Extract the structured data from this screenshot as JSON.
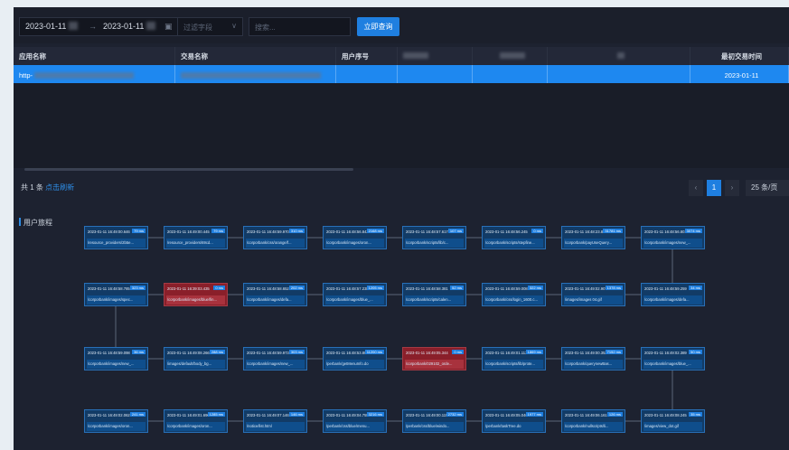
{
  "toolbar": {
    "start_date": "2023-01-11",
    "separator": "→",
    "end_date": "2023-01-11",
    "filter_placeholder": "过滤字段",
    "search_placeholder": "搜索...",
    "query_button": "立即查询"
  },
  "table": {
    "columns": [
      "应用名称",
      "交易名称",
      "用户序号",
      "",
      "",
      "",
      "最初交易时间"
    ],
    "row": {
      "app_name": "http-",
      "first_time": "2023-01-11"
    }
  },
  "pagination": {
    "total_prefix": "共",
    "total_count": "1",
    "total_suffix": "条",
    "refresh_link": "点击刷新",
    "prev": "‹",
    "current_page": "1",
    "next": "›",
    "page_size": "25 条/页"
  },
  "trail": {
    "title": "用户旅程",
    "nodes": [
      {
        "time": "2023-01-11 16:49:00.646",
        "dur": "79 ms",
        "path": "/resource_providers/2b5e...",
        "alert": false
      },
      {
        "time": "2023-01-11 16:49:00.445",
        "dur": "79 ms",
        "path": "/resource_providers/69cd...",
        "alert": false
      },
      {
        "time": "2023-01-11 16:48:59.970",
        "dur": "310 ms",
        "path": "/corporbank/css/orange/f...",
        "alert": false
      },
      {
        "time": "2023-01-11 16:48:56.842",
        "dur": "2168 ms",
        "path": "/corporbank/images/oron...",
        "alert": false
      },
      {
        "time": "2023-01-11 16:48:57.617",
        "dur": "107 ms",
        "path": "/corporbank/scripts/lib/c...",
        "alert": false
      },
      {
        "time": "2023-01-11 16:48:56.245",
        "dur": "0 ms",
        "path": "/corporbank/scripts/stepfine...",
        "alert": false
      },
      {
        "time": "2023-01-11 16:48:23.821",
        "dur": "31781 ms",
        "path": "/corporbank/payUseQuery...",
        "alert": false
      },
      {
        "time": "2023-01-11 16:48:56.801",
        "dur": "3074 ms",
        "path": "/corporbank/images/new_...",
        "alert": false
      },
      {
        "time": "2023-01-11 16:48:59.259",
        "dur": "34 ms",
        "path": "/corporbank/images/defa...",
        "alert": false
      },
      {
        "time": "2023-01-11 16:49:02.907",
        "dur": "1378 ms",
        "path": "/images/images 04.gif",
        "alert": false
      },
      {
        "time": "2023-01-11 16:48:59.008",
        "dur": "322 ms",
        "path": "/corporbank/css/login_1600.c...",
        "alert": false
      },
      {
        "time": "2023-01-11 16:48:58.381",
        "dur": "52 ms",
        "path": "/corporbank/scripts/calen...",
        "alert": false
      },
      {
        "time": "2023-01-11 16:48:57.238",
        "dur": "1205 ms",
        "path": "/corporbank/images/blue_...",
        "alert": false
      },
      {
        "time": "2023-01-11 16:48:58.652",
        "dur": "202 ms",
        "path": "/corporbank/images/defa...",
        "alert": false
      },
      {
        "time": "2023-01-11 16:39:03.435",
        "dur": "0 ms",
        "path": "/corporbank/images/blue/fin...",
        "alert": true
      },
      {
        "time": "2023-01-11 16:48:58.785",
        "dur": "323 ms",
        "path": "/corporbank/images/spec...",
        "alert": false
      },
      {
        "time": "2023-01-11 16:48:59.098",
        "dur": "36 ms",
        "path": "/corporbank/images/new_...",
        "alert": false
      },
      {
        "time": "2023-01-11 16:49:08.266",
        "dur": "288 ms",
        "path": "/images/default/body_bg...",
        "alert": false
      },
      {
        "time": "2023-01-11 16:48:59.973",
        "dur": "303 ms",
        "path": "/corporbank/images/new_...",
        "alert": false
      },
      {
        "time": "2023-01-11 16:48:53.807",
        "dur": "11200 ms",
        "path": "/perbank/getMenuInfo.do",
        "alert": false
      },
      {
        "time": "2023-01-11 16:49:05.344",
        "dur": "0 ms",
        "path": "/corporbank/029102_orde...",
        "alert": true
      },
      {
        "time": "2023-01-11 16:49:01.113",
        "dur": "1869 ms",
        "path": "/corporbank/scripts/lib/prote...",
        "alert": false
      },
      {
        "time": "2023-01-11 16:49:00.352",
        "dur": "7152 ms",
        "path": "/corporbank/querynewBas...",
        "alert": false
      },
      {
        "time": "2023-01-11 16:49:02.389",
        "dur": "50 ms",
        "path": "/corporbank/images/blue_...",
        "alert": false
      },
      {
        "time": "2023-01-11 16:49:08.245",
        "dur": "35 ms",
        "path": "/images/view_dot.gif",
        "alert": false
      },
      {
        "time": "2023-01-11 16:49:06.161",
        "dur": "126 ms",
        "path": "/corporbank/nullscripts/li...",
        "alert": false
      },
      {
        "time": "2023-01-11 16:49:05.046",
        "dur": "1977 ms",
        "path": "/perbank/taskTree.do",
        "alert": false
      },
      {
        "time": "2023-01-11 16:49:00.115",
        "dur": "2732 ms",
        "path": "/perbank/css/blue/windo...",
        "alert": false
      },
      {
        "time": "2023-01-11 16:49:04.755",
        "dur": "3216 ms",
        "path": "/perbank/css/blue/menu...",
        "alert": false
      },
      {
        "time": "2023-01-11 16:49:07.146",
        "dur": "146 ms",
        "path": "/notice/list.html",
        "alert": false
      },
      {
        "time": "2023-01-11 16:49:01.696",
        "dur": "1285 ms",
        "path": "/corporbank/images/oron...",
        "alert": false
      },
      {
        "time": "2023-01-11 16:49:02.062",
        "dur": "241 ms",
        "path": "/corporbank/images/oron...",
        "alert": false
      }
    ]
  }
}
